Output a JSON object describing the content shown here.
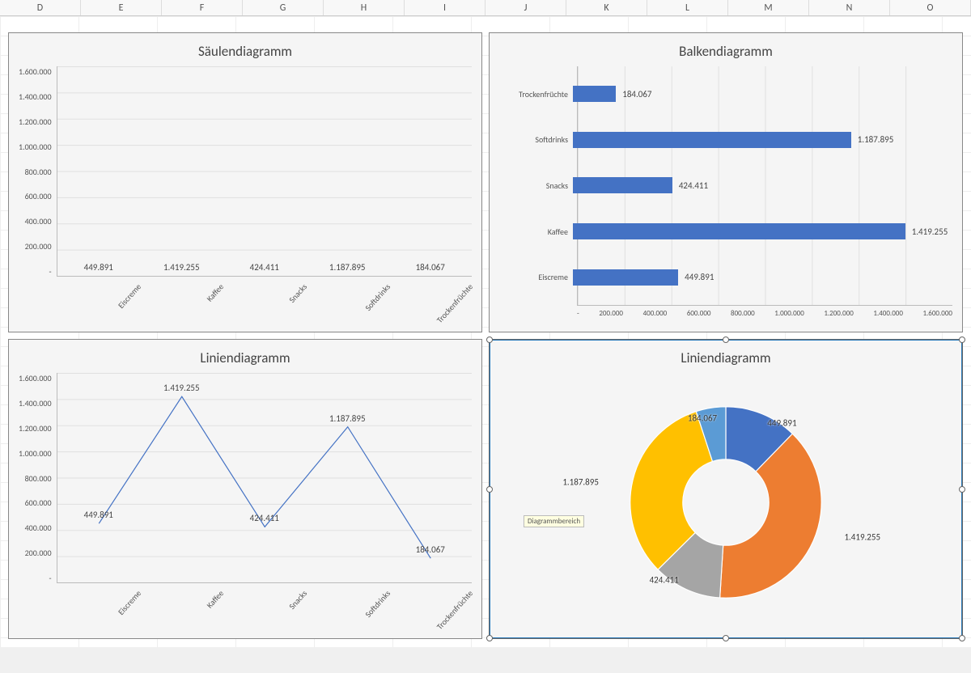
{
  "columns": [
    "D",
    "E",
    "F",
    "G",
    "H",
    "I",
    "J",
    "K",
    "L",
    "M",
    "N",
    "O"
  ],
  "charts": {
    "column": {
      "title": "Säulendiagramm",
      "yticks": [
        "1.600.000",
        "1.400.000",
        "1.200.000",
        "1.000.000",
        "800.000",
        "600.000",
        "400.000",
        "200.000",
        "-"
      ]
    },
    "bar": {
      "title": "Balkendiagramm",
      "xticks": [
        "-",
        "200.000",
        "400.000",
        "600.000",
        "800.000",
        "1.000.000",
        "1.200.000",
        "1.400.000",
        "1.600.000"
      ]
    },
    "line": {
      "title": "Liniendiagramm",
      "yticks": [
        "1.600.000",
        "1.400.000",
        "1.200.000",
        "1.000.000",
        "800.000",
        "600.000",
        "400.000",
        "200.000",
        "-"
      ]
    },
    "donut": {
      "title": "Liniendiagramm",
      "tooltip": "Diagrammbereich"
    }
  },
  "colors": {
    "bar": "#4472c4",
    "donut": [
      "#4472c4",
      "#ed7d31",
      "#a5a5a5",
      "#ffc000",
      "#5b9bd5"
    ]
  },
  "chart_data": [
    {
      "type": "bar",
      "orientation": "vertical",
      "title": "Säulendiagramm",
      "categories": [
        "Eiscreme",
        "Kaffee",
        "Snacks",
        "Softdrinks",
        "Trockenfrüchte"
      ],
      "values": [
        449891,
        1419255,
        424411,
        1187895,
        184067
      ],
      "labels": [
        "449.891",
        "1.419.255",
        "424.411",
        "1.187.895",
        "184.067"
      ],
      "ylim": [
        0,
        1600000
      ],
      "xlabel": "",
      "ylabel": ""
    },
    {
      "type": "bar",
      "orientation": "horizontal",
      "title": "Balkendiagramm",
      "categories": [
        "Trockenfrüchte",
        "Softdrinks",
        "Snacks",
        "Kaffee",
        "Eiscreme"
      ],
      "values": [
        184067,
        1187895,
        424411,
        1419255,
        449891
      ],
      "labels": [
        "184.067",
        "1.187.895",
        "424.411",
        "1.419.255",
        "449.891"
      ],
      "xlim": [
        0,
        1600000
      ],
      "xlabel": "",
      "ylabel": ""
    },
    {
      "type": "line",
      "title": "Liniendiagramm",
      "categories": [
        "Eiscreme",
        "Kaffee",
        "Snacks",
        "Softdrinks",
        "Trockenfrüchte"
      ],
      "values": [
        449891,
        1419255,
        424411,
        1187895,
        184067
      ],
      "labels": [
        "449.891",
        "1.419.255",
        "424.411",
        "1.187.895",
        "184.067"
      ],
      "ylim": [
        0,
        1600000
      ],
      "xlabel": "",
      "ylabel": ""
    },
    {
      "type": "pie",
      "subtype": "donut",
      "title": "Liniendiagramm",
      "categories": [
        "Eiscreme",
        "Kaffee",
        "Snacks",
        "Softdrinks",
        "Trockenfrüchte"
      ],
      "values": [
        449891,
        1419255,
        424411,
        1187895,
        184067
      ],
      "labels": [
        "449.891",
        "1.419.255",
        "424.411",
        "1.187.895",
        "184.067"
      ],
      "colors": [
        "#4472c4",
        "#ed7d31",
        "#a5a5a5",
        "#ffc000",
        "#5b9bd5"
      ]
    }
  ]
}
